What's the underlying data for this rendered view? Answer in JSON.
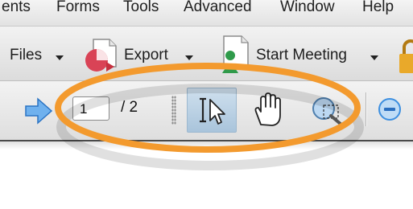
{
  "menu": {
    "items": [
      "ents",
      "Forms",
      "Tools",
      "Advanced",
      "Window",
      "Help"
    ]
  },
  "toolbar": {
    "files_label": "Files",
    "export_label": "Export",
    "start_meeting_label": "Start Meeting"
  },
  "navigation": {
    "current_page": "1",
    "page_count_text": "/ 2"
  },
  "icons": {
    "next_page": "arrow-right-icon",
    "select_tool": "text-select-cursor-icon",
    "hand_tool": "hand-icon",
    "marquee_zoom": "marquee-zoom-icon",
    "zoom_out": "zoom-out-icon",
    "export": "export-icon",
    "meeting": "meeting-icon",
    "lock": "lock-icon"
  },
  "colors": {
    "highlight_ring": "#f39a2e",
    "selected_tool_bg": "#b8cfe2",
    "accent_blue": "#3d8fe0"
  }
}
